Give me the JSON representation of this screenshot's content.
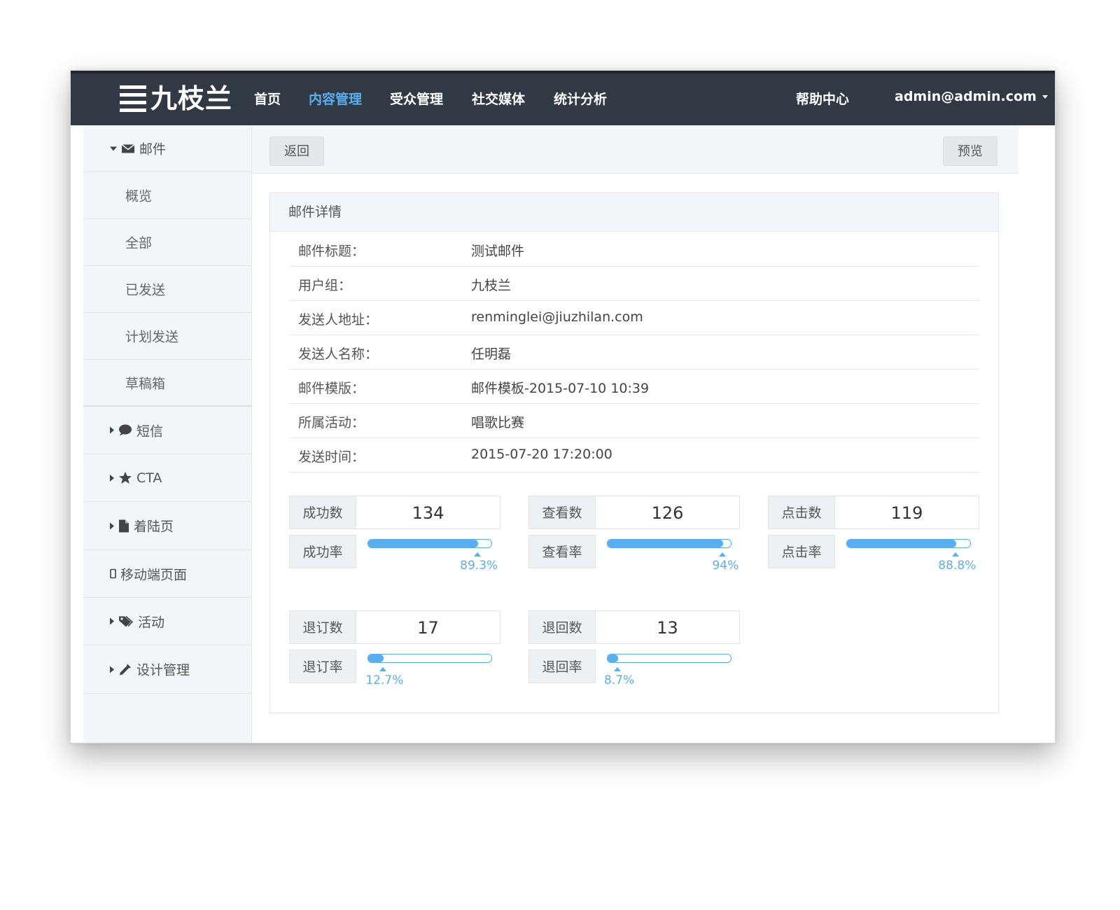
{
  "app": {
    "logo_text": "九枝兰"
  },
  "nav": {
    "items": [
      "首页",
      "内容管理",
      "受众管理",
      "社交媒体",
      "统计分析"
    ],
    "active": "内容管理",
    "help": "帮助中心",
    "user": "admin@admin.com"
  },
  "sidebar": {
    "email_group": "邮件",
    "email_items": [
      "概览",
      "全部",
      "已发送",
      "计划发送",
      "草稿箱"
    ],
    "groups": [
      "短信",
      "CTA",
      "着陆页",
      "移动端页面",
      "活动",
      "设计管理"
    ]
  },
  "toolbar": {
    "back_label": "返回",
    "preview_label": "预览"
  },
  "panel": {
    "title": "邮件详情",
    "rows": [
      {
        "label": "邮件标题：",
        "value": "测试邮件"
      },
      {
        "label": "用户组：",
        "value": "九枝兰"
      },
      {
        "label": "发送人地址：",
        "value": "renminglei@jiuzhilan.com"
      },
      {
        "label": "发送人名称：",
        "value": "任明磊"
      },
      {
        "label": "邮件模版：",
        "value": "邮件模板-2015-07-10 10:39"
      },
      {
        "label": "所属活动：",
        "value": "唱歌比赛"
      },
      {
        "label": "发送时间：",
        "value": "2015-07-20 17:20:00"
      }
    ]
  },
  "stats": [
    {
      "count_label": "成功数",
      "count": "134",
      "rate_label": "成功率",
      "rate": 89.3,
      "rate_text": "89.3%"
    },
    {
      "count_label": "查看数",
      "count": "126",
      "rate_label": "查看率",
      "rate": 94,
      "rate_text": "94%"
    },
    {
      "count_label": "点击数",
      "count": "119",
      "rate_label": "点击率",
      "rate": 88.8,
      "rate_text": "88.8%"
    },
    {
      "count_label": "退订数",
      "count": "17",
      "rate_label": "退订率",
      "rate": 12.7,
      "rate_text": "12.7%"
    },
    {
      "count_label": "退回数",
      "count": "13",
      "rate_label": "退回率",
      "rate": 8.7,
      "rate_text": "8.7%"
    }
  ],
  "colors": {
    "nav_bg": "#313945",
    "accent": "#5aaef0",
    "sidebar_bg": "#f3f6f8"
  }
}
